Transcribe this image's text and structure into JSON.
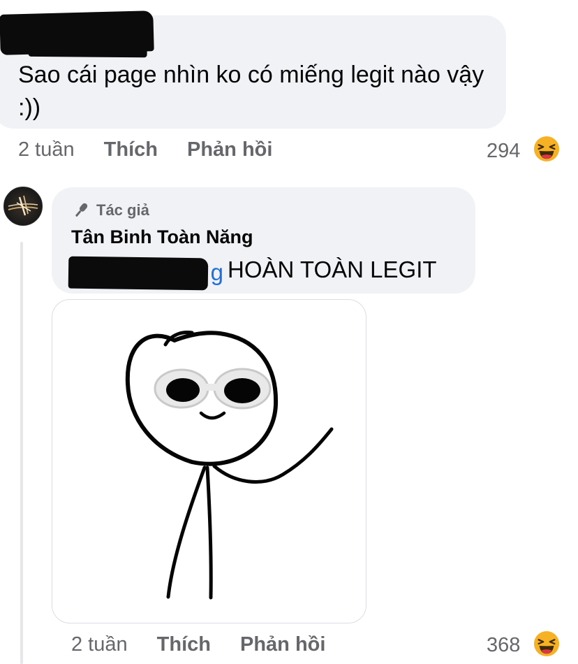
{
  "comment": {
    "author_redacted": true,
    "text": "Sao cái page nhìn ko có miếng legit nào vậy :))",
    "time": "2 tuần",
    "like_label": "Thích",
    "reply_label": "Phản hồi",
    "reaction_count": "294",
    "reaction_icon": "laughing-emoji-icon"
  },
  "reply": {
    "badge_label": "Tác giả",
    "badge_icon": "microphone-icon",
    "author_name": "Tân Binh Toàn Năng",
    "mention_tail": "g",
    "text": "HOÀN TOÀN LEGIT",
    "sticker_icon": "stick-figure-sunglasses-sticker",
    "time": "2 tuần",
    "like_label": "Thích",
    "reply_label": "Phản hồi",
    "reaction_count": "368",
    "reaction_icon": "laughing-emoji-icon"
  },
  "colors": {
    "bubble": "#f0f2f5",
    "meta_text": "#65676b",
    "mention": "#216fdb",
    "emoji_face": "#f7b125"
  }
}
